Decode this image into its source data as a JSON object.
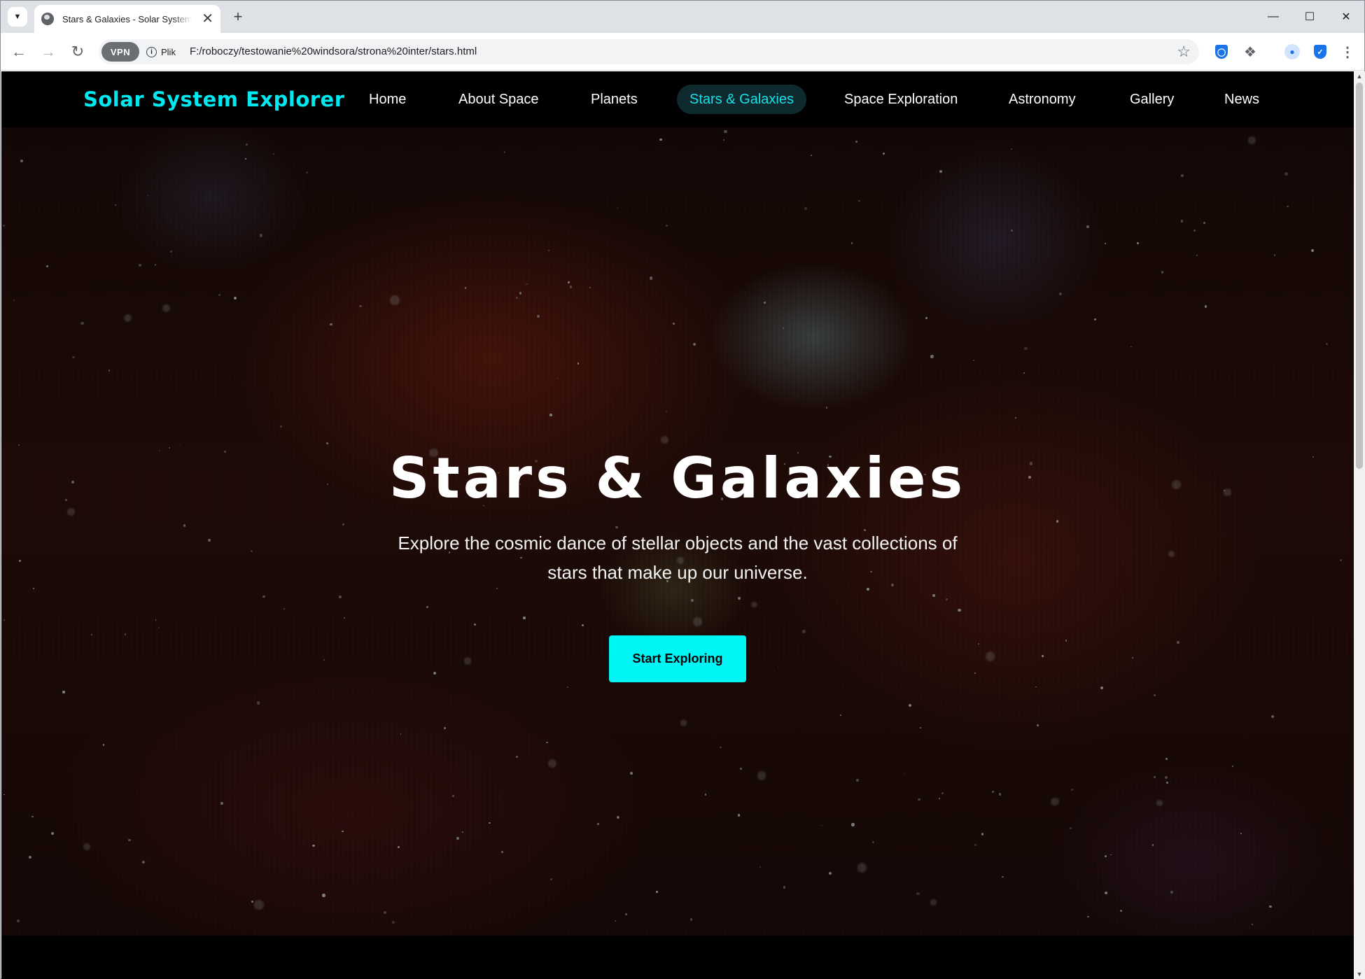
{
  "browser": {
    "tab_title": "Stars & Galaxies - Solar System Explorer",
    "new_tab_symbol": "+",
    "url": "F:/roboczy/testowanie%20windsora/strona%20inter/stars.html",
    "site_info_label": "Plik",
    "vpn_label": "VPN",
    "window_controls": {
      "minimize": "—",
      "maximize": "☐",
      "close": "✕"
    }
  },
  "site": {
    "logo": "Solar System Explorer",
    "nav": [
      {
        "label": "Home",
        "active": false
      },
      {
        "label": "About Space",
        "active": false
      },
      {
        "label": "Planets",
        "active": false
      },
      {
        "label": "Stars & Galaxies",
        "active": true
      },
      {
        "label": "Space Exploration",
        "active": false
      },
      {
        "label": "Astronomy",
        "active": false
      },
      {
        "label": "Gallery",
        "active": false
      },
      {
        "label": "News",
        "active": false
      }
    ],
    "accent_color": "#00f0f0"
  },
  "hero": {
    "title": "Stars & Galaxies",
    "subtitle": "Explore the cosmic dance of stellar objects and the vast collections of stars that make up our universe.",
    "cta_label": "Start Exploring"
  }
}
